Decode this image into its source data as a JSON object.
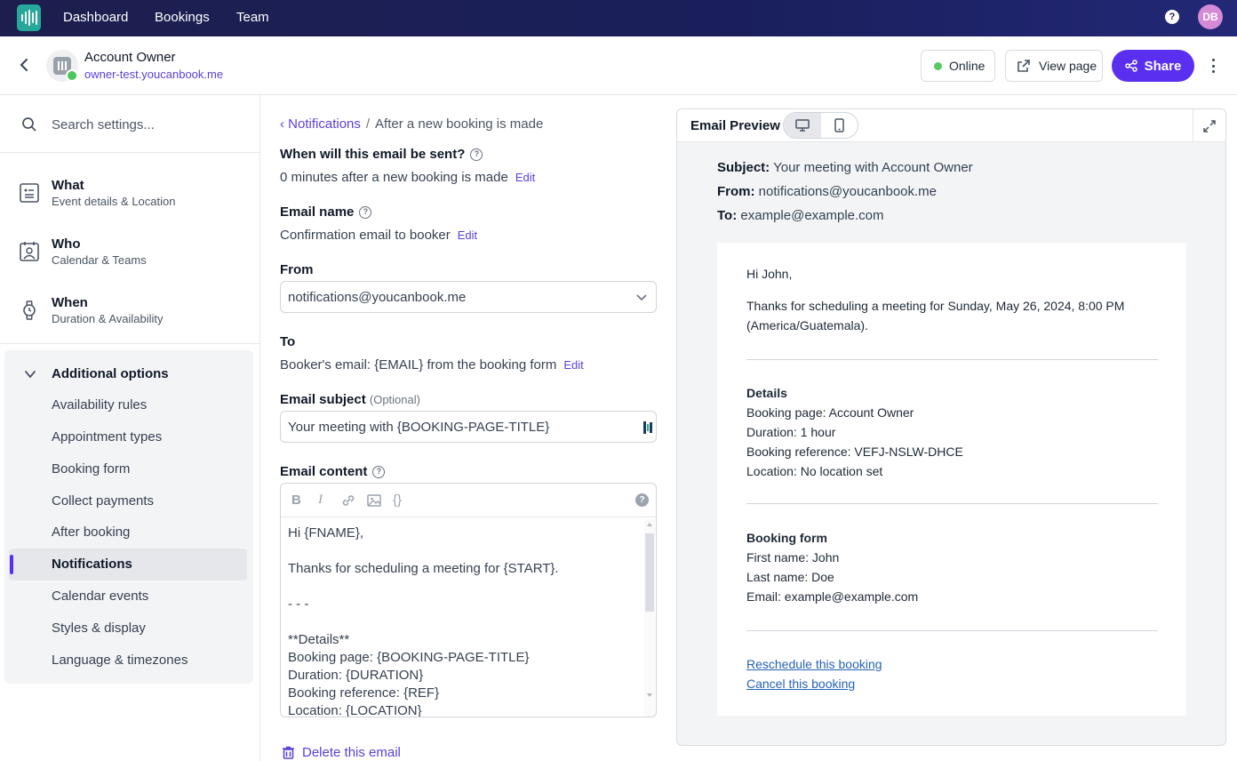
{
  "nav": {
    "items": [
      "Dashboard",
      "Bookings",
      "Team"
    ],
    "help": "?",
    "avatar": "DB"
  },
  "header": {
    "name": "Account Owner",
    "url": "owner-test.youcanbook.me",
    "online": "Online",
    "view_page": "View page",
    "share": "Share"
  },
  "sidebar": {
    "search_placeholder": "Search settings...",
    "main": [
      {
        "title": "What",
        "sub": "Event details & Location"
      },
      {
        "title": "Who",
        "sub": "Calendar & Teams"
      },
      {
        "title": "When",
        "sub": "Duration & Availability"
      }
    ],
    "additional_title": "Additional options",
    "items": [
      "Availability rules",
      "Appointment types",
      "Booking form",
      "Collect payments",
      "After booking",
      "Notifications",
      "Calendar events",
      "Styles & display",
      "Language & timezones"
    ],
    "active_item": "Notifications"
  },
  "middle": {
    "crumb_link": "Notifications",
    "crumb_sep": "/",
    "crumb_current": "After a new booking is made",
    "when_label": "When will this email be sent?",
    "when_value": "0 minutes after a new booking is made",
    "edit": "Edit",
    "name_label": "Email name",
    "name_value": "Confirmation email to booker",
    "from_label": "From",
    "from_value": "notifications@youcanbook.me",
    "to_label": "To",
    "to_value": "Booker's email: {EMAIL} from the booking form",
    "subject_label": "Email subject",
    "subject_optional": "(Optional)",
    "subject_value": "Your meeting with {BOOKING-PAGE-TITLE}",
    "content_label": "Email content",
    "toolbar": {
      "bold": "B",
      "italic": "I",
      "braces": "{}",
      "help": "?"
    },
    "content_lines": [
      "Hi {FNAME},",
      "",
      "Thanks for scheduling a meeting for {START}.",
      "",
      "- - -",
      "",
      "**Details**",
      "Booking page: {BOOKING-PAGE-TITLE}",
      "Duration: {DURATION}",
      "Booking reference: {REF}",
      "Location: {LOCATION}"
    ],
    "delete": "Delete this email"
  },
  "preview": {
    "title": "Email Preview",
    "subject_key": "Subject:",
    "subject_val": "Your meeting with Account Owner",
    "from_key": "From:",
    "from_val": "notifications@youcanbook.me",
    "to_key": "To:",
    "to_val": "example@example.com",
    "greeting": "Hi John,",
    "thanks_1": "Thanks for scheduling a meeting for Sunday, May 26, 2024, 8:00 PM",
    "thanks_2": "(America/Guatemala).",
    "details_title": "Details",
    "details": [
      "Booking page: Account Owner",
      "Duration: 1 hour",
      "Booking reference: VEFJ-NSLW-DHCE",
      "Location: No location set"
    ],
    "form_title": "Booking form",
    "form": [
      "First name: John",
      "Last name: Doe",
      "Email: example@example.com"
    ],
    "reschedule": "Reschedule this booking",
    "cancel": "Cancel this booking"
  },
  "colors": {
    "accent": "#5b2ff0",
    "link": "#5b3fd9",
    "online": "#58c962",
    "nav_bg": "#1c1f4d"
  }
}
